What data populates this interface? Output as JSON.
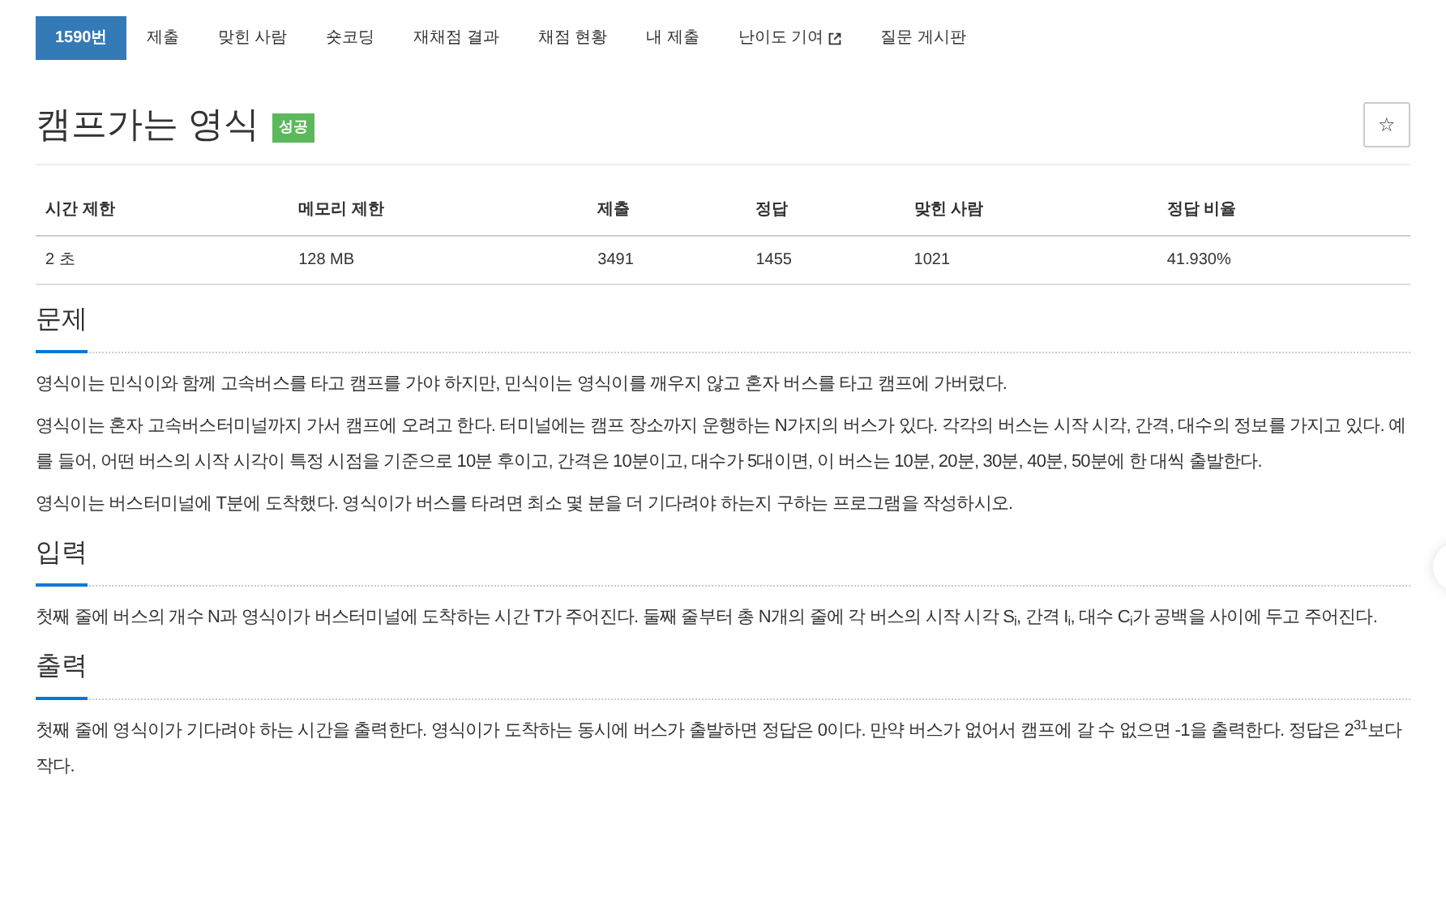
{
  "tabs": [
    {
      "label": "1590번",
      "selected": true,
      "external": false
    },
    {
      "label": "제출",
      "selected": false,
      "external": false
    },
    {
      "label": "맞힌 사람",
      "selected": false,
      "external": false
    },
    {
      "label": "숏코딩",
      "selected": false,
      "external": false
    },
    {
      "label": "재채점 결과",
      "selected": false,
      "external": false
    },
    {
      "label": "채점 현황",
      "selected": false,
      "external": false
    },
    {
      "label": "내 제출",
      "selected": false,
      "external": false
    },
    {
      "label": "난이도 기여",
      "selected": false,
      "external": true
    },
    {
      "label": "질문 게시판",
      "selected": false,
      "external": false
    }
  ],
  "title": "캠프가는 영식",
  "badge": "성공",
  "star_button": "☆",
  "info_table": {
    "columns": [
      "시간 제한",
      "메모리 제한",
      "제출",
      "정답",
      "맞힌 사람",
      "정답 비율"
    ],
    "rows": [
      [
        "2 초",
        "128 MB",
        "3491",
        "1455",
        "1021",
        "41.930%"
      ]
    ]
  },
  "sections": [
    {
      "heading": "문제",
      "paragraphs": [
        "영식이는 민식이와 함께 고속버스를 타고 캠프를 가야 하지만, 민식이는 영식이를 깨우지 않고 혼자 버스를 타고 캠프에 가버렸다.",
        "영식이는 혼자 고속버스터미널까지 가서 캠프에 오려고 한다. 터미널에는 캠프 장소까지 운행하는 N가지의 버스가 있다. 각각의 버스는 시작 시각, 간격, 대수의 정보를 가지고 있다. 예를 들어, 어떤 버스의 시작 시각이 특정 시점을 기준으로 10분 후이고, 간격은 10분이고, 대수가 5대이면, 이 버스는 10분, 20분, 30분, 40분, 50분에 한 대씩 출발한다.",
        "영식이는 버스터미널에 T분에 도착했다. 영식이가 버스를 타려면 최소 몇 분을 더 기다려야 하는지 구하는 프로그램을 작성하시오."
      ]
    },
    {
      "heading": "입력",
      "paragraphs": [
        "첫째 줄에 버스의 개수 N과 영식이가 버스터미널에 도착하는 시간 T가 주어진다. 둘째 줄부터 총 N개의 줄에 각 버스의 시작 시각 S$_{i}$, 간격 I$_{i}$, 대수 C$_{i}$가 공백을 사이에 두고 주어진다."
      ]
    },
    {
      "heading": "출력",
      "paragraphs": [
        "첫째 줄에 영식이가 기다려야 하는 시간을 출력한다. 영식이가 도착하는 동시에 버스가 출발하면 정답은 0이다. 만약 버스가 없어서 캠프에 갈 수 없으면 -1을 출력한다. 정답은 2$^{31}$보다 작다."
      ]
    }
  ]
}
